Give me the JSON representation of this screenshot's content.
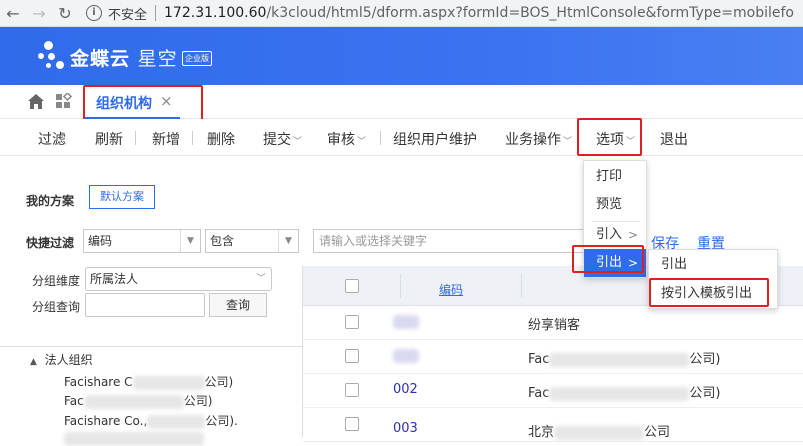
{
  "browser": {
    "insecure_label": "不安全",
    "url_host": "172.31.100.60",
    "url_path": "/k3cloud/html5/dform.aspx?formId=BOS_HtmlConsole&formType=mobilefo"
  },
  "brand": {
    "name": "金蝶云",
    "product": "星空",
    "edition": "企业版"
  },
  "tabs": [
    {
      "label": "组织机构",
      "active": true
    }
  ],
  "toolbar": {
    "items": [
      "过滤",
      "刷新",
      "新增",
      "删除",
      "提交",
      "审核",
      "组织用户维护",
      "业务操作",
      "选项",
      "退出"
    ]
  },
  "options_menu": {
    "items": [
      "打印",
      "预览",
      "引入",
      "引出"
    ]
  },
  "export_submenu": {
    "items": [
      "引出",
      "按引入模板引出"
    ]
  },
  "scheme": {
    "label": "我的方案",
    "default_button": "默认方案"
  },
  "quick_filter": {
    "label": "快捷过滤",
    "field": "编码",
    "operator": "包含",
    "placeholder": "请输入或选择关键字",
    "save": "保存",
    "reset": "重置"
  },
  "group": {
    "dimension_label": "分组维度",
    "dimension_value": "所属法人",
    "query_label": "分组查询",
    "query_button": "查询"
  },
  "tree": {
    "root": "法人组织",
    "children": [
      "Facishare C",
      "Fac",
      "Facishare Co.,",
      ""
    ],
    "suffixes": [
      "公司)",
      "公司)",
      "公司).",
      ""
    ]
  },
  "grid": {
    "columns": [
      "编码"
    ],
    "rows": [
      {
        "code": "",
        "name": "纷享销客"
      },
      {
        "code": "",
        "name": "Fac",
        "suffix": "公司)"
      },
      {
        "code": "002",
        "name": "Fac",
        "suffix": "公司)"
      },
      {
        "code": "003",
        "name": "北京",
        "suffix": "公司"
      }
    ]
  },
  "colors": {
    "brand_blue": "#2f6bea",
    "highlight_red": "#e02020"
  }
}
